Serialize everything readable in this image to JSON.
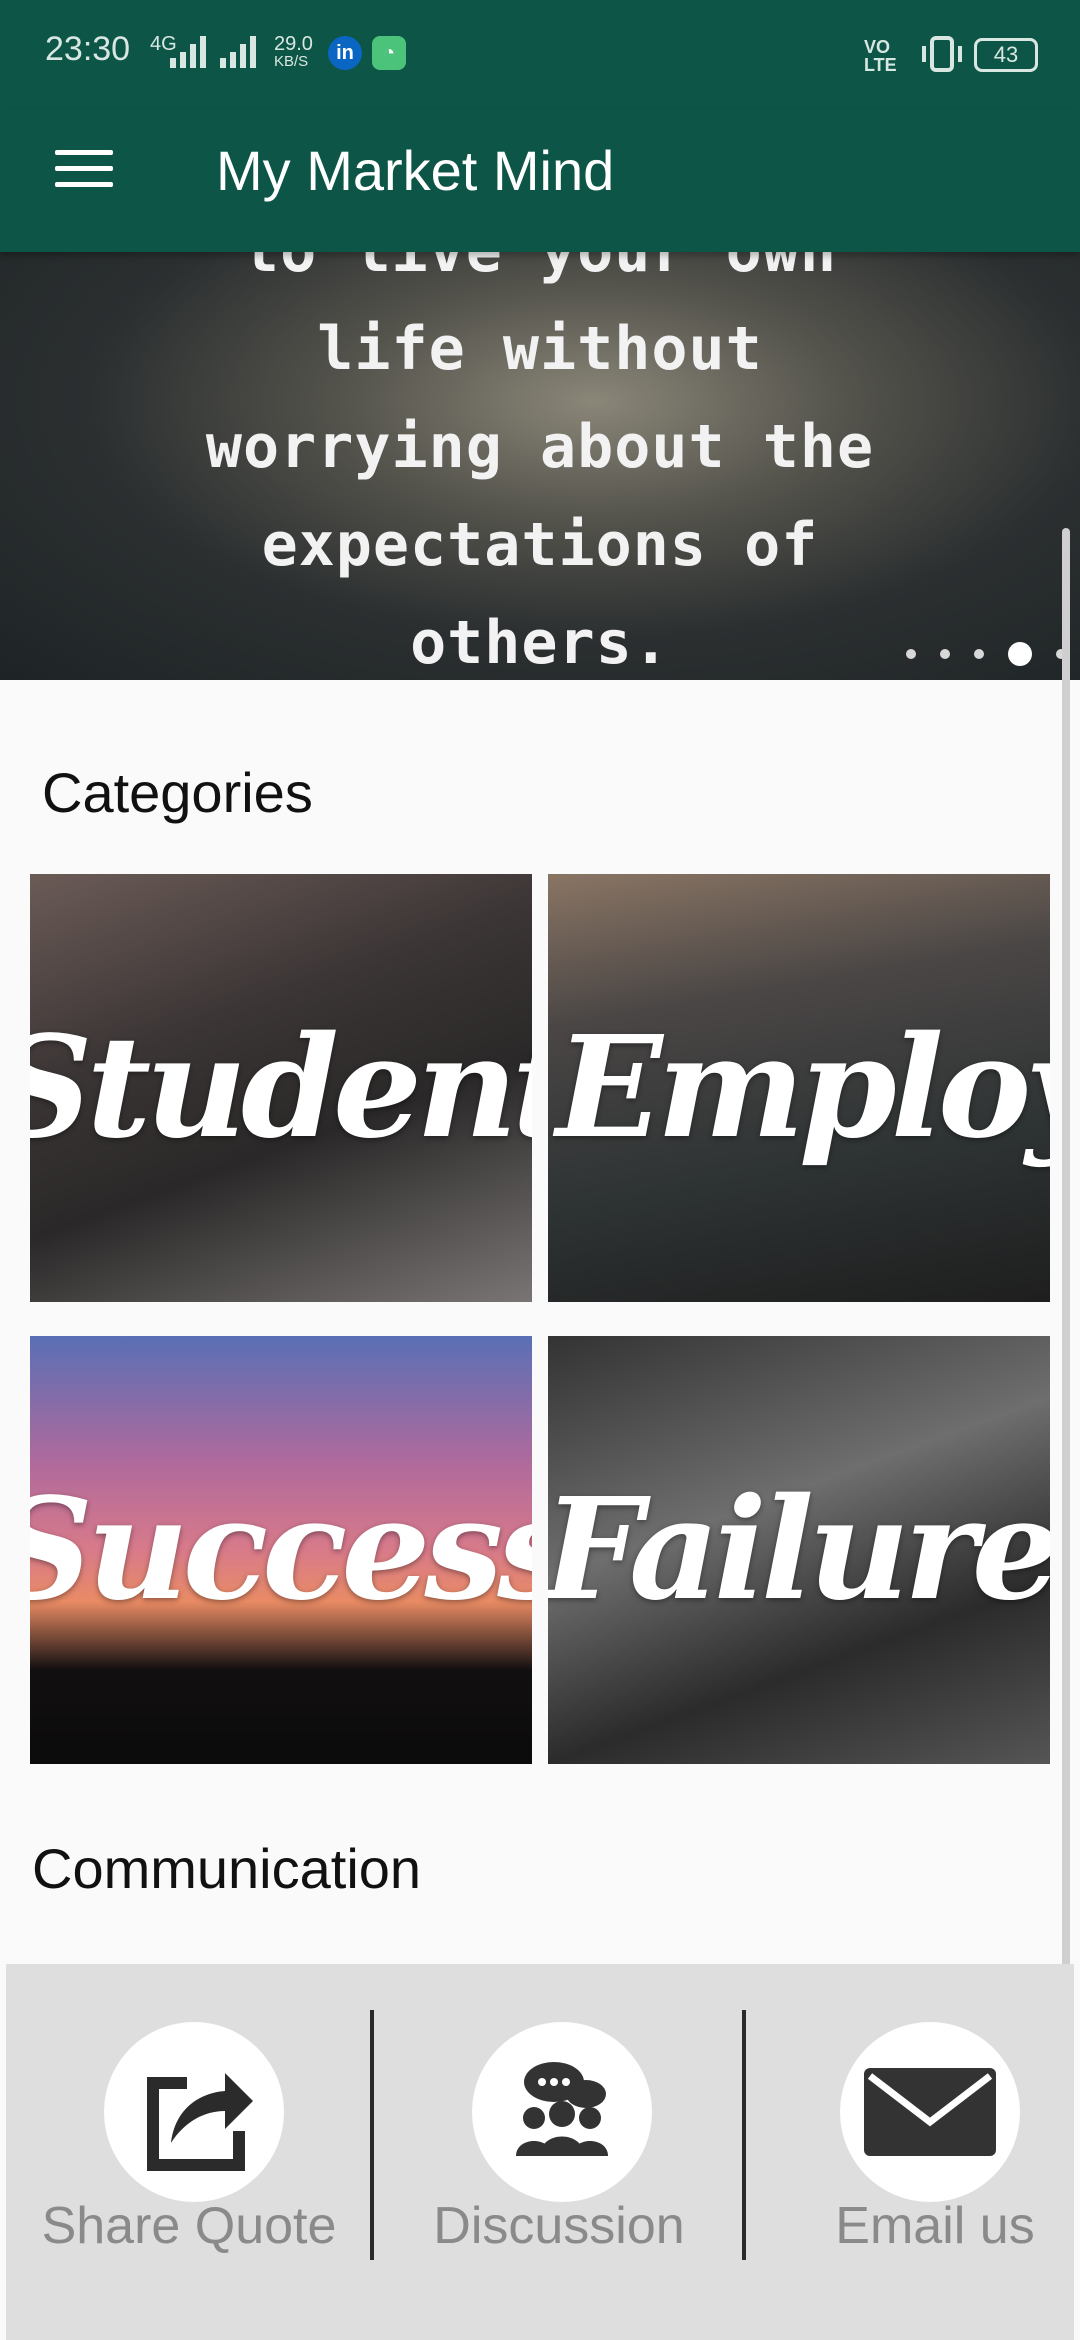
{
  "status": {
    "time": "23:30",
    "network": "4G",
    "speed_top": "29.0",
    "speed_bottom": "KB/S",
    "volte": "VO LTE",
    "battery": "43"
  },
  "appbar": {
    "title": "My Market Mind"
  },
  "banner": {
    "quote_lines": [
      "to live your own",
      "life without",
      "worrying about the",
      "expectations of",
      "others."
    ],
    "page_count": 5,
    "active_page": 4
  },
  "categories": {
    "title": "Categories",
    "items": [
      {
        "label": "Student"
      },
      {
        "label": "Employee"
      },
      {
        "label": "Success"
      },
      {
        "label": "Failure"
      }
    ]
  },
  "communication": {
    "title": "Communication",
    "actions": [
      {
        "label": "Share Quote",
        "icon": "share-icon"
      },
      {
        "label": "Discussion",
        "icon": "discussion-icon"
      },
      {
        "label": "Email us",
        "icon": "email-icon"
      }
    ]
  },
  "colors": {
    "primary": "#0d5647",
    "bottom_bar": "#dedede"
  }
}
